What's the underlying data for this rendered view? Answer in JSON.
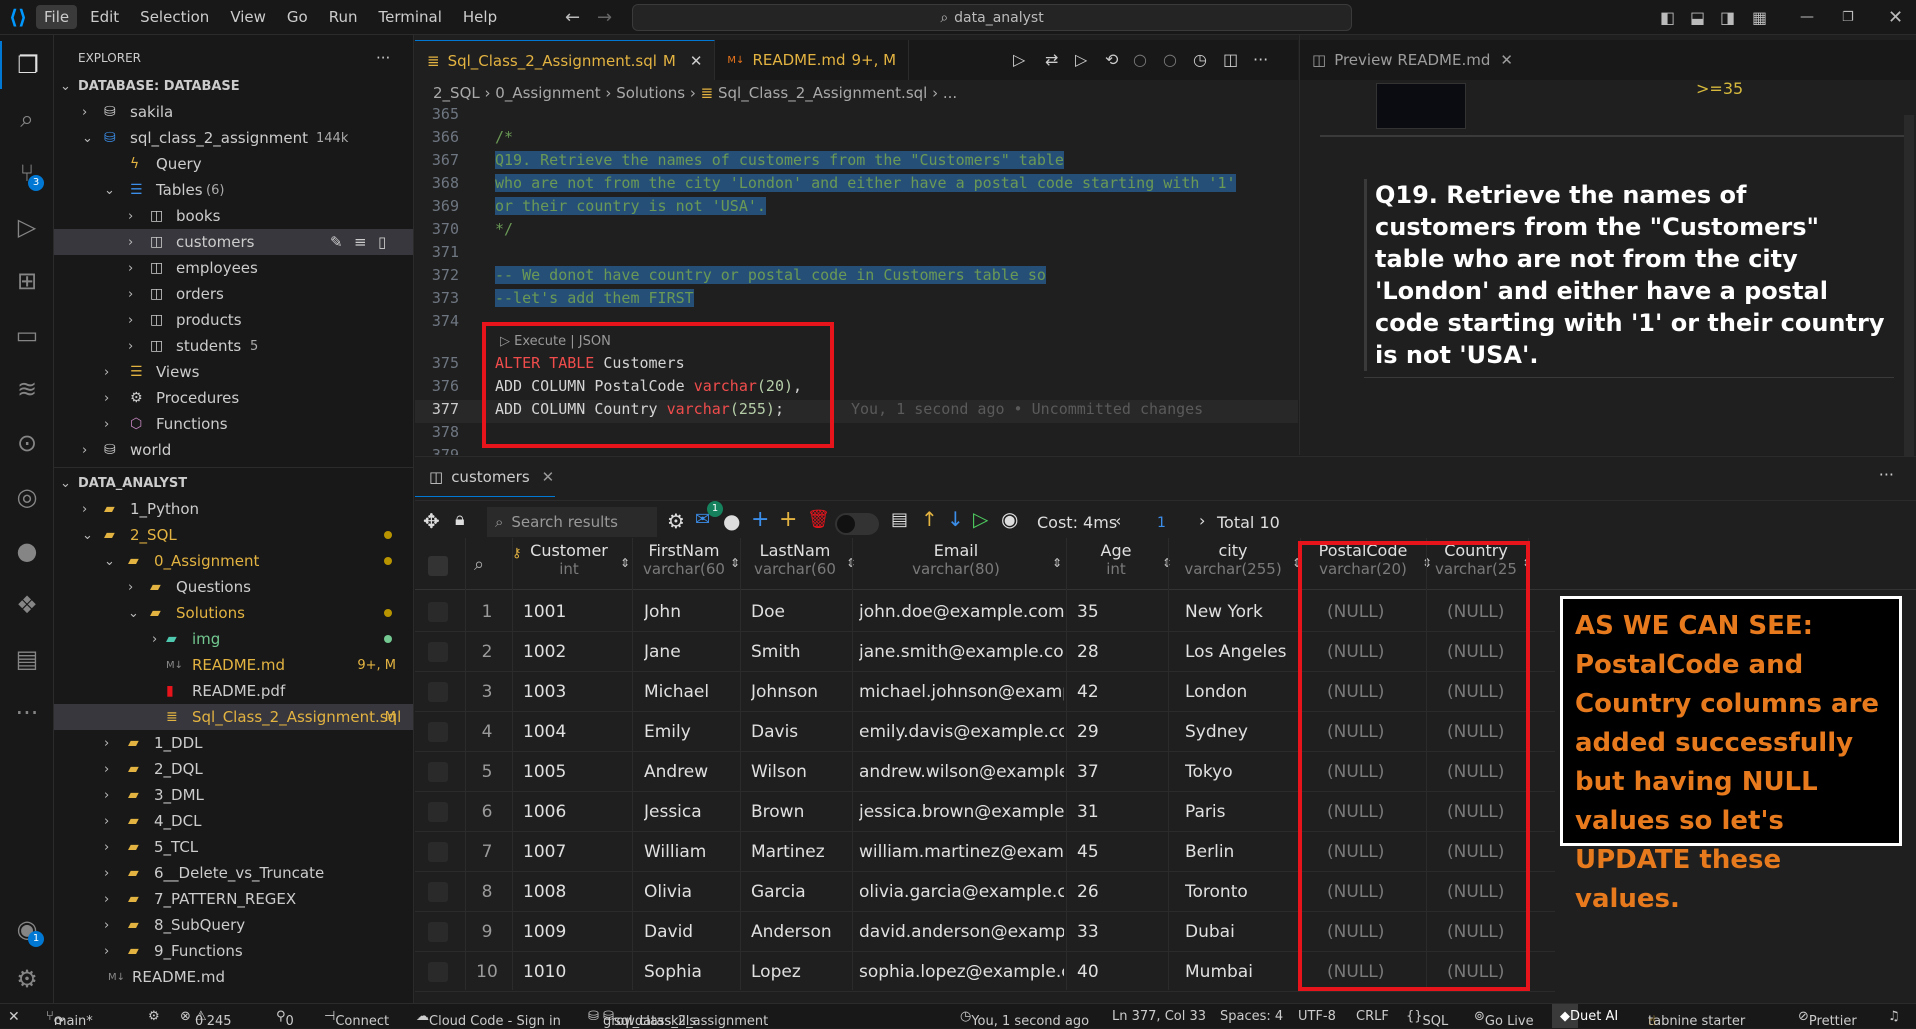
{
  "menu": {
    "file": "File",
    "edit": "Edit",
    "selection": "Selection",
    "view": "View",
    "go": "Go",
    "run": "Run",
    "terminal": "Terminal",
    "help": "Help"
  },
  "command_center": "data_analyst",
  "activity": {
    "scm_badge": "3",
    "account_badge": "1"
  },
  "sidebar": {
    "title": "EXPLORER",
    "db_section": "DATABASE: DATABASE",
    "sakila": "sakila",
    "db_file": "sql_class_2_assignment",
    "db_size": "144k",
    "query": "Query",
    "tables": "Tables",
    "tables_count": "(6)",
    "books": "books",
    "customers": "customers",
    "employees": "employees",
    "orders": "orders",
    "products": "products",
    "students": "students",
    "students_count": "5",
    "views": "Views",
    "procedures": "Procedures",
    "functions": "Functions",
    "world": "world",
    "project_section": "DATA_ANALYST",
    "python": "1_Python",
    "sql": "2_SQL",
    "assignment": "0_Assignment",
    "questions": "Questions",
    "solutions": "Solutions",
    "img": "img",
    "readme_md": "README.md",
    "readme_md_status": "9+, M",
    "readme_pdf": "README.pdf",
    "sql_file": "Sql_Class_2_Assignment.sql",
    "sql_file_status": "M",
    "ddl": "1_DDL",
    "dql": "2_DQL",
    "dml": "3_DML",
    "dcl": "4_DCL",
    "tcl": "5_TCL",
    "delete": "6__Delete_vs_Truncate",
    "regex": "7_PATTERN_REGEX",
    "subquery": "8_SubQuery",
    "functions_dir": "9_Functions",
    "root_readme": "README.md"
  },
  "tabs": {
    "sql_tab": "Sql_Class_2_Assignment.sql",
    "sql_tab_status": "M",
    "readme_tab": "README.md",
    "readme_tab_status": "9+, M",
    "preview_tab": "Preview README.md"
  },
  "breadcrumb": {
    "p1": "2_SQL",
    "p2": "0_Assignment",
    "p3": "Solutions",
    "p4": "Sql_Class_2_Assignment.sql",
    "p5": "..."
  },
  "code": {
    "l365": "365",
    "l366": "366",
    "l367": "367",
    "l368": "368",
    "l369": "369",
    "l370": "370",
    "l371": "371",
    "l372": "372",
    "l373": "373",
    "l374": "374",
    "l375": "375",
    "l376": "376",
    "l377": "377",
    "l378": "378",
    "l379": "379",
    "c366": "/*",
    "c367": "Q19. Retrieve the names of customers from the \"Customers\" table",
    "c368": "who are not from the city 'London' and either have a postal code starting with '1'",
    "c369": "or their country is not 'USA'.",
    "c370": "*/",
    "c372": "-- We donot have country or postal code in Customers table so",
    "c373": "--let's add them FIRST",
    "codelens": "Execute | JSON",
    "c375_kw": "ALTER TABLE",
    "c375_rest": " Customers",
    "c376_kw": "ADD COLUMN",
    "c376_col": " PostalCode ",
    "c376_type": "varchar",
    "c376_num": "(20)",
    "c376_end": ",",
    "c377_kw": "ADD COLUMN",
    "c377_col": " Country ",
    "c377_type": "varchar",
    "c377_num": "(255)",
    "c377_end": ";",
    "blame": "You, 1 second ago • Uncommitted changes"
  },
  "preview": {
    "thumb_text": ">=35",
    "heading": "Q19. Retrieve the names of customers from the \"Customers\" table who are not from the city 'London' and either have a postal code starting with '1' or their country is not 'USA'."
  },
  "results": {
    "tab": "customers",
    "search_placeholder": "Search results",
    "mail_badge": "1",
    "cost": "Cost: 4ms",
    "page": "1",
    "total": "Total 10",
    "columns": [
      {
        "name": "Customer",
        "type": "int"
      },
      {
        "name": "FirstNam",
        "type": "varchar(60"
      },
      {
        "name": "LastNam",
        "type": "varchar(60"
      },
      {
        "name": "Email",
        "type": "varchar(80)"
      },
      {
        "name": "Age",
        "type": "int"
      },
      {
        "name": "city",
        "type": "varchar(255)"
      },
      {
        "name": "PostalCode",
        "type": "varchar(20)"
      },
      {
        "name": "Country",
        "type": "varchar(25"
      }
    ],
    "rows": [
      [
        "1",
        "1001",
        "John",
        "Doe",
        "john.doe@example.com",
        "35",
        "New York",
        "(NULL)",
        "(NULL)"
      ],
      [
        "2",
        "1002",
        "Jane",
        "Smith",
        "jane.smith@example.com",
        "28",
        "Los Angeles",
        "(NULL)",
        "(NULL)"
      ],
      [
        "3",
        "1003",
        "Michael",
        "Johnson",
        "michael.johnson@example.",
        "42",
        "London",
        "(NULL)",
        "(NULL)"
      ],
      [
        "4",
        "1004",
        "Emily",
        "Davis",
        "emily.davis@example.com",
        "29",
        "Sydney",
        "(NULL)",
        "(NULL)"
      ],
      [
        "5",
        "1005",
        "Andrew",
        "Wilson",
        "andrew.wilson@example.cc",
        "37",
        "Tokyo",
        "(NULL)",
        "(NULL)"
      ],
      [
        "6",
        "1006",
        "Jessica",
        "Brown",
        "jessica.brown@example.coi",
        "31",
        "Paris",
        "(NULL)",
        "(NULL)"
      ],
      [
        "7",
        "1007",
        "William",
        "Martinez",
        "william.martinez@example.",
        "45",
        "Berlin",
        "(NULL)",
        "(NULL)"
      ],
      [
        "8",
        "1008",
        "Olivia",
        "Garcia",
        "olivia.garcia@example.com",
        "26",
        "Toronto",
        "(NULL)",
        "(NULL)"
      ],
      [
        "9",
        "1009",
        "David",
        "Anderson",
        "david.anderson@example.c",
        "33",
        "Dubai",
        "(NULL)",
        "(NULL)"
      ],
      [
        "10",
        "1010",
        "Sophia",
        "Lopez",
        "sophia.lopez@example.coi",
        "40",
        "Mumbai",
        "(NULL)",
        "(NULL)"
      ]
    ]
  },
  "annotation": "AS WE CAN SEE: PostalCode and Country columns are added successfully but having NULL values so let's UPDATE these values.",
  "status": {
    "branch": "main*",
    "problems": "0",
    "warnings": "245",
    "ports": "0",
    "connect": "Connect",
    "cloud": "Cloud Code - Sign in",
    "conn1": "growdataskills",
    "conn2": "sql_class_2_assignment",
    "blame": "You, 1 second ago",
    "position": "Ln 377, Col 33",
    "spaces": "Spaces: 4",
    "encoding": "UTF-8",
    "eol": "CRLF",
    "lang": "SQL",
    "golive": "Go Live",
    "duet": "Duet AI",
    "tabnine": "tabnine starter",
    "prettier": "Prettier"
  },
  "colors": {
    "accent": "#0078d4",
    "highlight": "#e8141c",
    "annotation_text": "#e87a1e",
    "modified": "#e3b341"
  }
}
